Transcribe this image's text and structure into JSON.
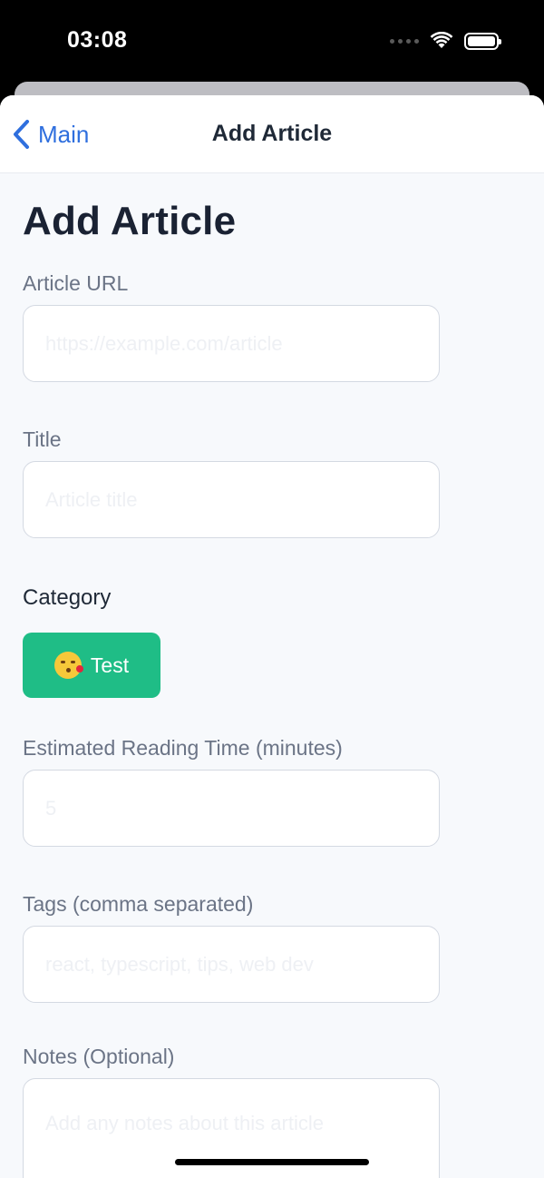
{
  "status_bar": {
    "time": "03:08"
  },
  "nav": {
    "back_label": "Main",
    "title": "Add Article"
  },
  "page": {
    "title": "Add Article"
  },
  "form": {
    "url": {
      "label": "Article URL",
      "placeholder": "https://example.com/article",
      "value": ""
    },
    "title": {
      "label": "Title",
      "placeholder": "Article title",
      "value": ""
    },
    "category": {
      "label": "Category",
      "chip_label": "Test",
      "chip_color": "#1fbd86"
    },
    "reading_time": {
      "label": "Estimated Reading Time (minutes)",
      "placeholder": "5",
      "value": ""
    },
    "tags": {
      "label": "Tags (comma separated)",
      "placeholder": "react, typescript, tips, web dev",
      "value": ""
    },
    "notes": {
      "label": "Notes (Optional)",
      "placeholder": "Add any notes about this article",
      "value": ""
    }
  },
  "colors": {
    "accent": "#2f6fde",
    "chip": "#1fbd86",
    "title": "#1a2233"
  }
}
